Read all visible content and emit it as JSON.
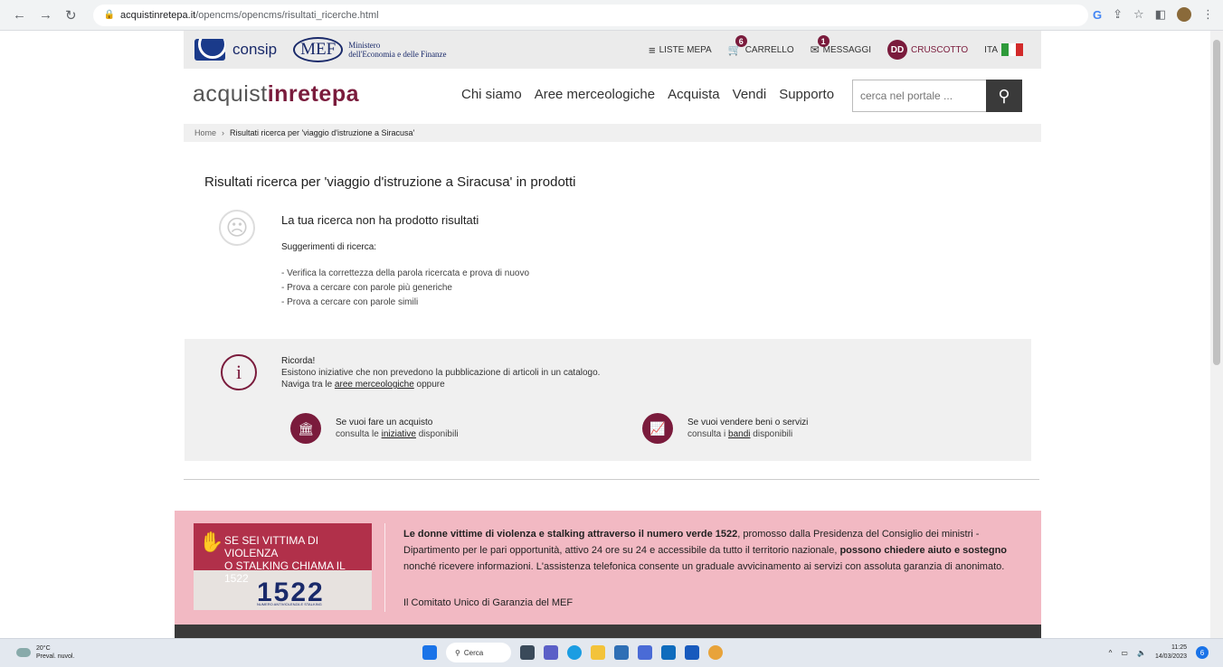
{
  "browser": {
    "url_host": "acquistinretepa.it",
    "url_path": "/opencms/opencms/risultati_ricerche.html"
  },
  "topbar": {
    "consip": "consip",
    "mef": "MEF",
    "mef_line1": "Ministero",
    "mef_line2": "dell'Economia e delle Finanze",
    "liste_mepa": "LISTE MEPA",
    "carrello": "CARRELLO",
    "carrello_count": "6",
    "messaggi": "MESSAGGI",
    "messaggi_count": "1",
    "user_initials": "DD",
    "cruscotto": "CRUSCOTTO",
    "lang": "ITA"
  },
  "header": {
    "brand_a": "acquist",
    "brand_b": "inrete",
    "brand_c": "pa",
    "nav": [
      "Chi siamo",
      "Aree merceologiche",
      "Acquista",
      "Vendi",
      "Supporto"
    ],
    "search_placeholder": "cerca nel portale ..."
  },
  "breadcrumb": {
    "home": "Home",
    "current": "Risultati ricerca per 'viaggio d'istruzione a Siracusa'"
  },
  "results": {
    "title": "Risultati ricerca per 'viaggio d'istruzione a Siracusa' in prodotti",
    "no_results": "La tua ricerca non ha prodotto risultati",
    "suggestions_title": "Suggerimenti di ricerca:",
    "suggestions": [
      "- Verifica la correttezza della parola ricercata e prova di nuovo",
      "- Prova a cercare con parole più generiche",
      "- Prova a cercare con parole simili"
    ]
  },
  "info": {
    "title": "Ricorda!",
    "line1": "Esistono iniziative che non prevedono la pubblicazione di articoli in un catalogo.",
    "line2_pre": "Naviga tra le",
    "line2_link": "aree merceologiche",
    "line2_post": "oppure",
    "buy_title": "Se vuoi fare un acquisto",
    "buy_pre": "consulta le",
    "buy_link": "iniziative",
    "buy_post": "disponibili",
    "sell_title": "Se vuoi vendere beni o servizi",
    "sell_pre": "consulta i",
    "sell_link": "bandi",
    "sell_post": "disponibili"
  },
  "banner": {
    "poster_line1": "SE SEI VITTIMA DI VIOLENZA",
    "poster_line2": "O STALKING CHIAMA IL 1522",
    "poster_number": "1522",
    "poster_small": "NUMERO ANTIVIOLENZA E STALKING",
    "text_b1": "Le donne vittime di violenza e stalking attraverso il numero verde 1522",
    "text_1": ", promosso dalla Presidenza del Consiglio dei ministri - Dipartimento per le pari opportunità, attivo 24 ore su 24 e accessibile da tutto il territorio nazionale, ",
    "text_b2": "possono chiedere aiuto e sostegno",
    "text_2": " nonché ricevere informazioni. L'assistenza telefonica consente un graduale avvicinamento ai servizi con assoluta garanzia di anonimato.",
    "link": "Il Comitato Unico di Garanzia del MEF"
  },
  "taskbar": {
    "temp": "20°C",
    "weather": "Preval. nuvol.",
    "search": "Cerca",
    "time": "11:25",
    "date": "14/03/2023",
    "notif": "6"
  },
  "colors": {
    "accent": "#7a1b3c",
    "banner": "#f2b9c3"
  }
}
